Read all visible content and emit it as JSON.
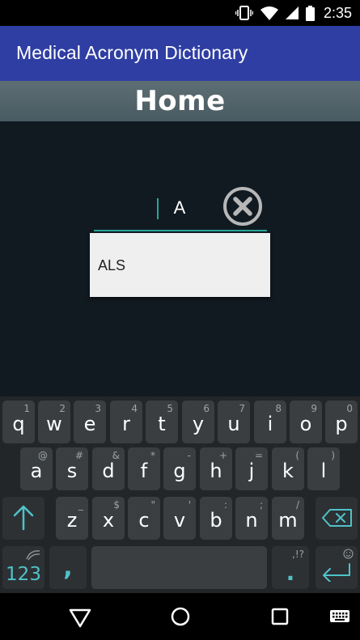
{
  "status": {
    "time": "2:35"
  },
  "app": {
    "title": "Medical Acronym Dictionary"
  },
  "page": {
    "heading": "Home"
  },
  "search": {
    "value": "A",
    "placeholder": ""
  },
  "suggestions": [
    {
      "label": "ALS"
    }
  ],
  "keyboard": {
    "row1": [
      {
        "key": "q",
        "hint": "1"
      },
      {
        "key": "w",
        "hint": "2"
      },
      {
        "key": "e",
        "hint": "3"
      },
      {
        "key": "r",
        "hint": "4"
      },
      {
        "key": "t",
        "hint": "5"
      },
      {
        "key": "y",
        "hint": "6"
      },
      {
        "key": "u",
        "hint": "7"
      },
      {
        "key": "i",
        "hint": "8"
      },
      {
        "key": "o",
        "hint": "9"
      },
      {
        "key": "p",
        "hint": "0"
      }
    ],
    "row2": [
      {
        "key": "a",
        "hint": "@"
      },
      {
        "key": "s",
        "hint": "#"
      },
      {
        "key": "d",
        "hint": "&"
      },
      {
        "key": "f",
        "hint": "*"
      },
      {
        "key": "g",
        "hint": "-"
      },
      {
        "key": "h",
        "hint": "+"
      },
      {
        "key": "j",
        "hint": "="
      },
      {
        "key": "k",
        "hint": "("
      },
      {
        "key": "l",
        "hint": ")"
      }
    ],
    "row3": [
      {
        "key": "z",
        "hint": "_"
      },
      {
        "key": "x",
        "hint": "$"
      },
      {
        "key": "c",
        "hint": "\""
      },
      {
        "key": "v",
        "hint": "'"
      },
      {
        "key": "b",
        "hint": ":"
      },
      {
        "key": "n",
        "hint": ";"
      },
      {
        "key": "m",
        "hint": "/"
      }
    ],
    "numbers_label": "123",
    "comma_label": ",",
    "period_label": ".",
    "period_hint": ",!?",
    "accent_color": "#4fc3c9"
  },
  "icons": {
    "status": [
      "vibrate-icon",
      "wifi-icon",
      "signal-icon",
      "battery-icon"
    ],
    "search_clear": "close-circle-icon",
    "keyboard": [
      "shift-icon",
      "backspace-icon",
      "swiftkey-icon",
      "emoji-icon",
      "enter-icon"
    ],
    "nav": [
      "back-icon",
      "home-icon",
      "recents-icon",
      "keyboard-switch-icon"
    ]
  },
  "colors": {
    "app_bar": "#2f3ea3",
    "accent": "#26a69a",
    "banner": "#526369",
    "background": "#111a21"
  }
}
